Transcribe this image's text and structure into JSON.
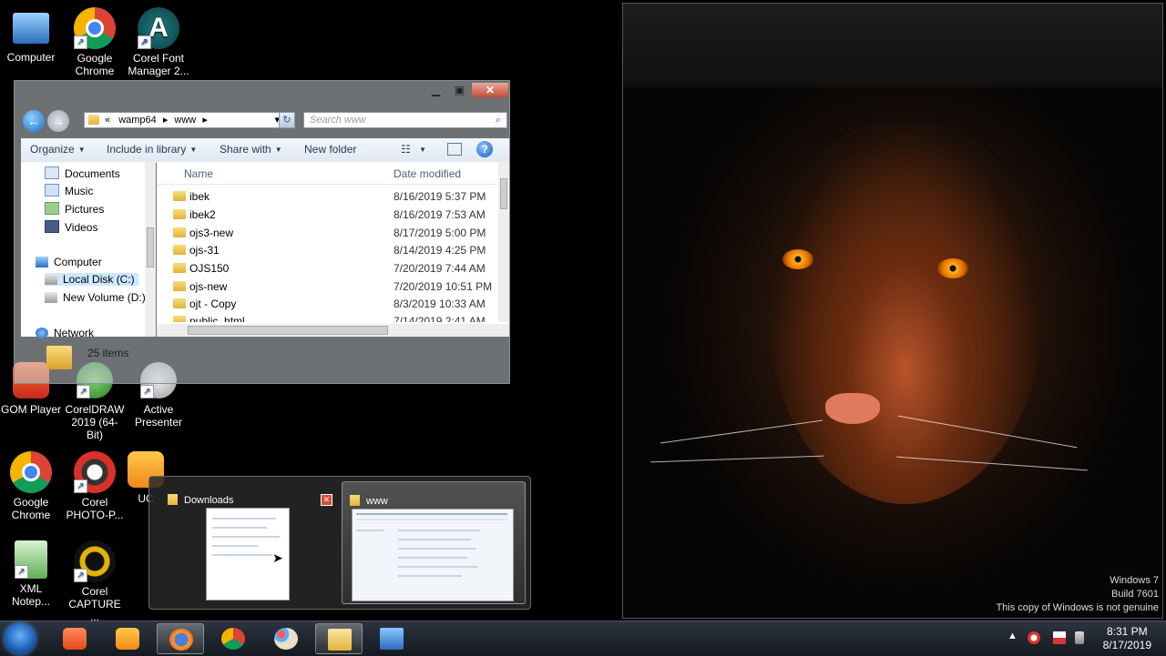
{
  "desktop_icons": [
    {
      "label": "Computer",
      "icon": "computer-icon"
    },
    {
      "label": "Google Chrome",
      "icon": "chrome-icon"
    },
    {
      "label": "Corel Font Manager 2...",
      "icon": "corel-font-manager-icon"
    },
    {
      "label": "GOM Player",
      "icon": "gom-player-icon"
    },
    {
      "label": "CorelDRAW 2019 (64-Bit)",
      "icon": "coreldraw-icon"
    },
    {
      "label": "Active Presenter",
      "icon": "active-presenter-icon"
    },
    {
      "label": "Google Chrome",
      "icon": "chrome-icon"
    },
    {
      "label": "Corel PHOTO-P...",
      "icon": "corel-photo-paint-icon"
    },
    {
      "label": "UC",
      "icon": "uc-browser-icon"
    },
    {
      "label": "XML Notep...",
      "icon": "xml-notepad-icon"
    },
    {
      "label": "Corel CAPTURE ...",
      "icon": "corel-capture-icon"
    }
  ],
  "explorer": {
    "breadcrumb": [
      "«",
      "wamp64",
      "www"
    ],
    "search_placeholder": "Search www",
    "toolbar": {
      "organize": "Organize",
      "include_in_library": "Include in library",
      "share_with": "Share with",
      "new_folder": "New folder"
    },
    "nav_items": [
      "Documents",
      "Music",
      "Pictures",
      "Videos",
      "Computer",
      "Local Disk (C:)",
      "New Volume (D:)",
      "Network"
    ],
    "columns": {
      "name": "Name",
      "date_modified": "Date modified"
    },
    "files": [
      {
        "name": "ibek",
        "date": "8/16/2019 5:37 PM"
      },
      {
        "name": "ibek2",
        "date": "8/16/2019 7:53 AM"
      },
      {
        "name": "ojs3-new",
        "date": "8/17/2019 5:00 PM"
      },
      {
        "name": "ojs-31",
        "date": "8/14/2019 4:25 PM"
      },
      {
        "name": "OJS150",
        "date": "7/20/2019 7:44 AM"
      },
      {
        "name": "ojs-new",
        "date": "7/20/2019 10:51 PM"
      },
      {
        "name": "ojt - Copy",
        "date": "8/3/2019 10:33 AM"
      },
      {
        "name": "public_html",
        "date": "7/14/2019 2:41 AM"
      }
    ],
    "status": "25 items"
  },
  "previews": [
    {
      "title": "Downloads"
    },
    {
      "title": "www"
    }
  ],
  "watermark": {
    "line1": "Windows 7",
    "line2": "Build 7601",
    "line3": "This copy of Windows is not genuine"
  },
  "clock": {
    "time": "8:31 PM",
    "date": "8/17/2019"
  }
}
